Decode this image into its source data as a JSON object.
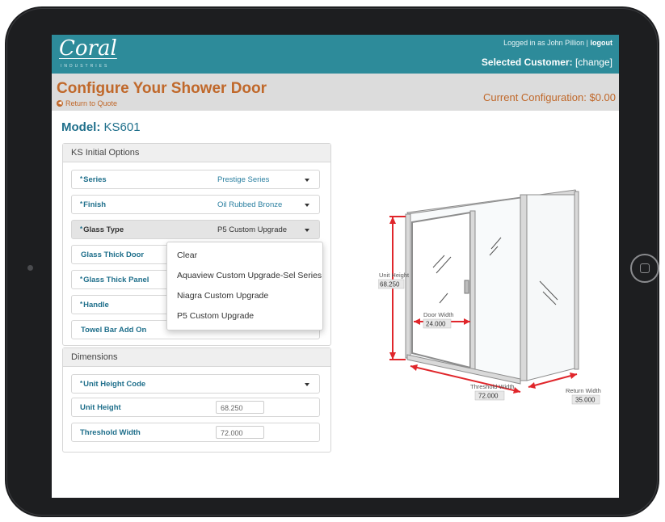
{
  "header": {
    "logo": "Coral",
    "logo_sub": "INDUSTRIES",
    "login_text": "Logged in as John Pillion | ",
    "logout": "logout",
    "selected_customer_label": "Selected Customer: ",
    "change": "[change]"
  },
  "page": {
    "title": "Configure Your Shower Door",
    "return_link": "Return to Quote",
    "current_configuration": "Current Configuration: $0.00"
  },
  "model": {
    "label": "Model:",
    "value": "KS601"
  },
  "initial_options": {
    "heading": "KS Initial Options",
    "rows": [
      {
        "label": "Series",
        "value": "Prestige Series",
        "required": "*"
      },
      {
        "label": "Finish",
        "value": "Oil Rubbed Bronze",
        "required": "*"
      },
      {
        "label": "Glass Type",
        "value": "P5 Custom Upgrade",
        "required": "*"
      },
      {
        "label": "Glass Thick Door",
        "value": "",
        "required": ""
      },
      {
        "label": "Glass Thick Panel",
        "value": "",
        "required": "*"
      },
      {
        "label": "Handle",
        "value": "",
        "required": "*"
      },
      {
        "label": "Towel Bar Add On",
        "value": "",
        "required": ""
      }
    ]
  },
  "glass_type_dropdown": {
    "options": [
      "Clear",
      "Aquaview Custom Upgrade-Sel Series",
      "Niagra Custom Upgrade",
      "P5 Custom Upgrade"
    ]
  },
  "dimensions": {
    "heading": "Dimensions",
    "unit_height_code": {
      "label": "Unit Height Code",
      "required": "*"
    },
    "unit_height": {
      "label": "Unit Height",
      "value": "68.250"
    },
    "threshold_width": {
      "label": "Threshold Width",
      "value": "72.000"
    }
  },
  "diagram": {
    "unit_height_label": "Unit Height",
    "unit_height_value": "68.250",
    "door_width_label": "Door Width",
    "door_width_value": "24.000",
    "threshold_width_label": "Threshold Width",
    "threshold_width_value": "72.000",
    "return_width_label": "Return Width",
    "return_width_value": "35.000"
  },
  "colors": {
    "header": "#2d8b9a",
    "accent": "#c0682a",
    "label": "#1f6f8b",
    "dimension": "#e0262b"
  }
}
